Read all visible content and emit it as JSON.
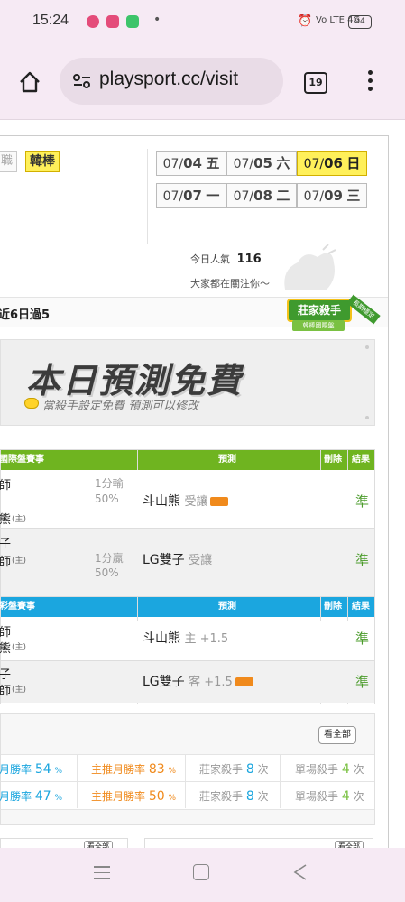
{
  "status_bar": {
    "time": "15:24",
    "dot": "•",
    "network": "Vo LTE 4G",
    "battery": "94"
  },
  "browser": {
    "url": "playsport.cc/visit",
    "tab_count": "19"
  },
  "league_tags": [
    "職",
    "韓棒"
  ],
  "dates": {
    "row1": [
      {
        "prefix": "07/",
        "day": "04",
        "weekday": "五",
        "selected": false
      },
      {
        "prefix": "07/",
        "day": "05",
        "weekday": "六",
        "selected": false
      },
      {
        "prefix": "07/",
        "day": "06",
        "weekday": "日",
        "selected": true
      }
    ],
    "row2": [
      {
        "prefix": "07/",
        "day": "07",
        "weekday": "一",
        "selected": false
      },
      {
        "prefix": "07/",
        "day": "08",
        "weekday": "二",
        "selected": false
      },
      {
        "prefix": "07/",
        "day": "09",
        "weekday": "三",
        "selected": false
      }
    ]
  },
  "popularity": {
    "label": "今日人氣",
    "value": "116",
    "sub": "大家都在關注你～"
  },
  "record": "近6日過5",
  "badge_text": {
    "title": "莊家殺手",
    "sub": "韓棒國際盤",
    "ribbon": "長期穩定"
  },
  "banner": {
    "title": "本日預測免費",
    "subtitle": "當殺手設定免費 預測可以修改"
  },
  "intl_table": {
    "header": {
      "game": "國際盤賽事",
      "prediction": "預測",
      "delete": "刪除",
      "result": "結果"
    },
    "rows": [
      {
        "team_a": "師",
        "team_b": "熊",
        "home": "(主)",
        "score": "1分輸",
        "pct": "50%",
        "pick_team": "斗山熊",
        "pick_type": "受讓",
        "result": "準"
      },
      {
        "team_a": "子",
        "team_b": "師",
        "home": "(主)",
        "score": "1分贏",
        "pct": "50%",
        "pick_team": "LG雙子",
        "pick_type": "受讓",
        "result": "準"
      }
    ]
  },
  "lottery_table": {
    "header": {
      "game": "彩盤賽事",
      "prediction": "預測",
      "delete": "刪除",
      "result": "結果"
    },
    "rows": [
      {
        "team_a": "師",
        "team_b": "熊",
        "home": "(主)",
        "pick_team": "斗山熊",
        "pick_type": "主 +1.5",
        "result": "準"
      },
      {
        "team_a": "子",
        "team_b": "師",
        "home": "(主)",
        "pick_team": "LG雙子",
        "pick_type": "客 +1.5",
        "result": "準"
      }
    ]
  },
  "stats": {
    "view_all": "看全部",
    "rows": [
      {
        "month_rate_label": "月勝率",
        "month_rate": "54",
        "main_label": "主推月勝率",
        "main_rate": "83",
        "killer_label": "莊家殺手",
        "killer_count": "8",
        "single_label": "單場殺手",
        "single_count": "4"
      },
      {
        "month_rate_label": "月勝率",
        "month_rate": "47",
        "main_label": "主推月勝率",
        "main_rate": "50",
        "killer_label": "莊家殺手",
        "killer_count": "8",
        "single_label": "單場殺手",
        "single_count": "4"
      }
    ],
    "pct": "%",
    "times": "次"
  },
  "bottom_partial": {
    "view_all_1": "看全部",
    "view_all_2": "看全部"
  },
  "colors": {
    "green": "#6fb420",
    "blue": "#1ba6df",
    "yellow": "#fff05a",
    "orange": "#f08a1c"
  }
}
